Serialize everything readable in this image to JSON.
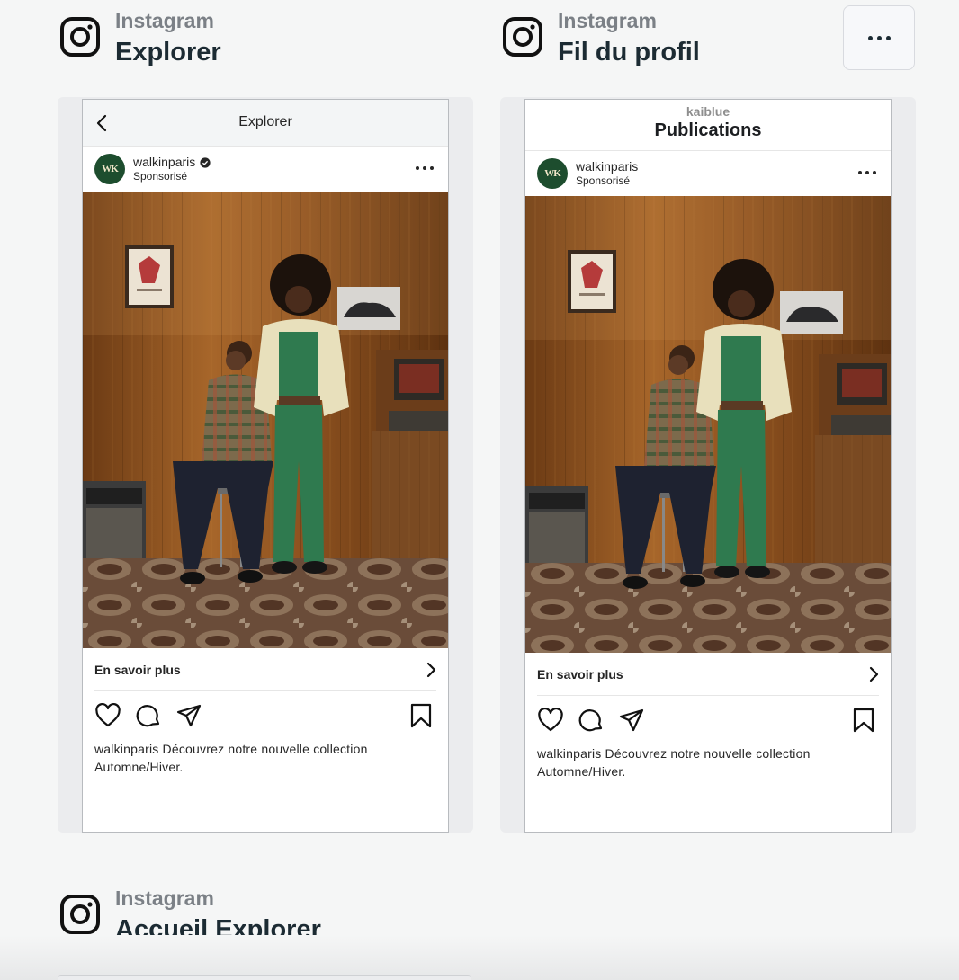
{
  "sections": [
    {
      "platform": "Instagram",
      "placement": "Explorer"
    },
    {
      "platform": "Instagram",
      "placement": "Fil du profil"
    },
    {
      "platform": "Instagram",
      "placement": "Accueil Explorer"
    }
  ],
  "previews": [
    {
      "topbar_title": "Explorer",
      "account": "walkinparis",
      "sponsored": "Sponsorisé",
      "avatar_text": "WK",
      "cta": "En savoir plus",
      "caption_account": "walkinparis",
      "caption_text": "Découvrez notre nouvelle collection Automne/Hiver."
    },
    {
      "topbar_sub": "kaiblue",
      "topbar_main": "Publications",
      "account": "walkinparis",
      "sponsored": "Sponsorisé",
      "avatar_text": "WK",
      "cta": "En savoir plus",
      "caption_account": "walkinparis",
      "caption_text": "Découvrez notre nouvelle collection Automne/Hiver."
    }
  ],
  "colors": {
    "avatar_bg": "#1d4d2e",
    "wood": "#8a4f1c",
    "jacket_green": "#2f7a4f",
    "page_bg": "#f5f6f6"
  },
  "icons": [
    "instagram-logo-icon",
    "more-options-icon",
    "back-chevron-icon",
    "verified-badge-icon",
    "heart-icon",
    "comment-icon",
    "share-icon",
    "bookmark-icon",
    "chevron-right-icon"
  ]
}
